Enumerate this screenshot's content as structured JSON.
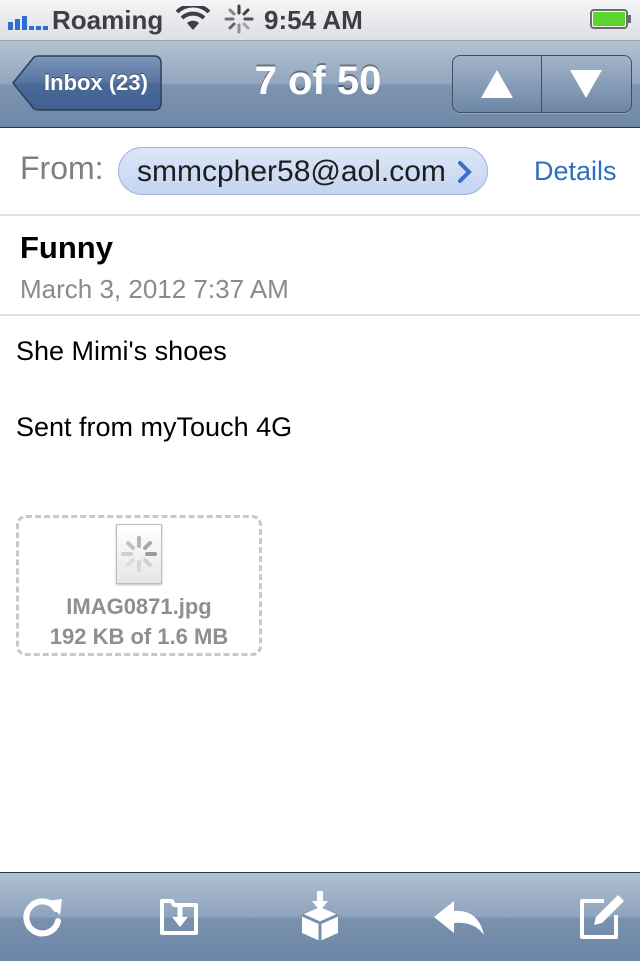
{
  "status": {
    "carrier": "Roaming",
    "time": "9:54 AM",
    "battery_color": "#5bd52b"
  },
  "nav": {
    "back_label": "Inbox (23)",
    "title": "7 of 50",
    "prev_icon": "up-arrow-icon",
    "next_icon": "down-arrow-icon"
  },
  "header": {
    "from_label": "From:",
    "from_address": "smmcpher58@aol.com",
    "details_label": "Details",
    "subject": "Funny",
    "date": "March 3, 2012 7:37 AM"
  },
  "body": {
    "lines": [
      "She Mimi's shoes",
      "Sent from myTouch 4G"
    ]
  },
  "attachment": {
    "filename": "IMAG0871.jpg",
    "progress_text": "192 KB of 1.6 MB",
    "downloaded_fraction": 0.12
  },
  "toolbar": {
    "icons": [
      "refresh-icon",
      "move-to-folder-icon",
      "archive-icon",
      "reply-icon",
      "compose-icon"
    ]
  },
  "colors": {
    "nav_bar": "#7d94b0",
    "link": "#2e6ec3",
    "pill": "#c4d5f1"
  }
}
